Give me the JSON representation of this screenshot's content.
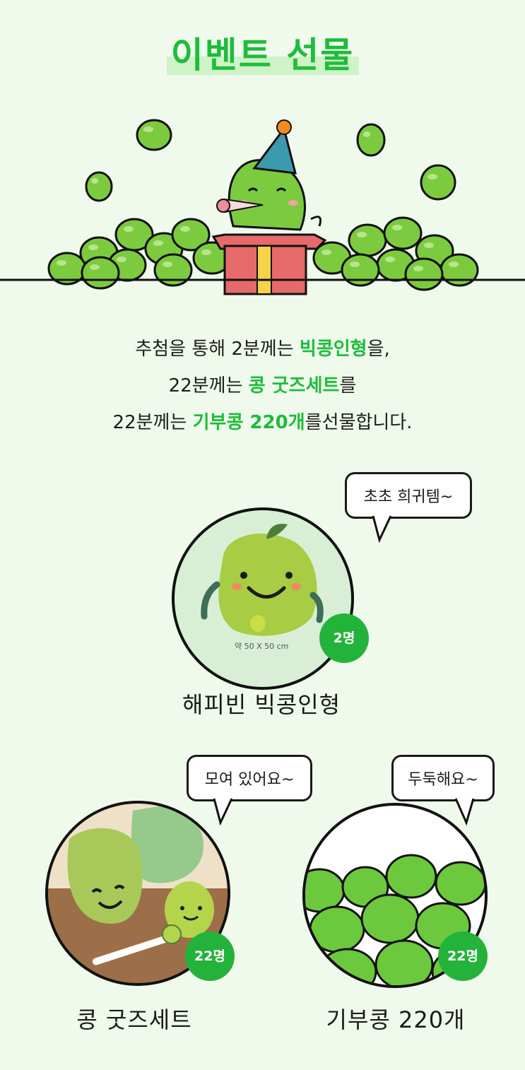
{
  "title": "이벤트 선물",
  "description": {
    "line1": {
      "pre": "추첨을 통해 2분께는 ",
      "hl": "빅콩인형",
      "post": "을,"
    },
    "line2": {
      "pre": "22분께는 ",
      "hl": "콩 굿즈세트",
      "post": "를"
    },
    "line3": {
      "pre": "22분께는 ",
      "hl": "기부콩 220개",
      "post": "를선물합니다."
    }
  },
  "items": [
    {
      "name": "해피빈 빅콩인형",
      "badge": "2명",
      "bubble": "초초 희귀템~",
      "size_label": "약 50 X 50 cm"
    },
    {
      "name": "콩 굿즈세트",
      "badge": "22명",
      "bubble": "모여 있어요~"
    },
    {
      "name": "기부콩 220개",
      "badge": "22명",
      "bubble": "두둑해요~"
    }
  ],
  "colors": {
    "accent": "#1fbc3b",
    "bean": "#7ccb3f",
    "background": "#effaec",
    "badge": "#24b33a"
  }
}
